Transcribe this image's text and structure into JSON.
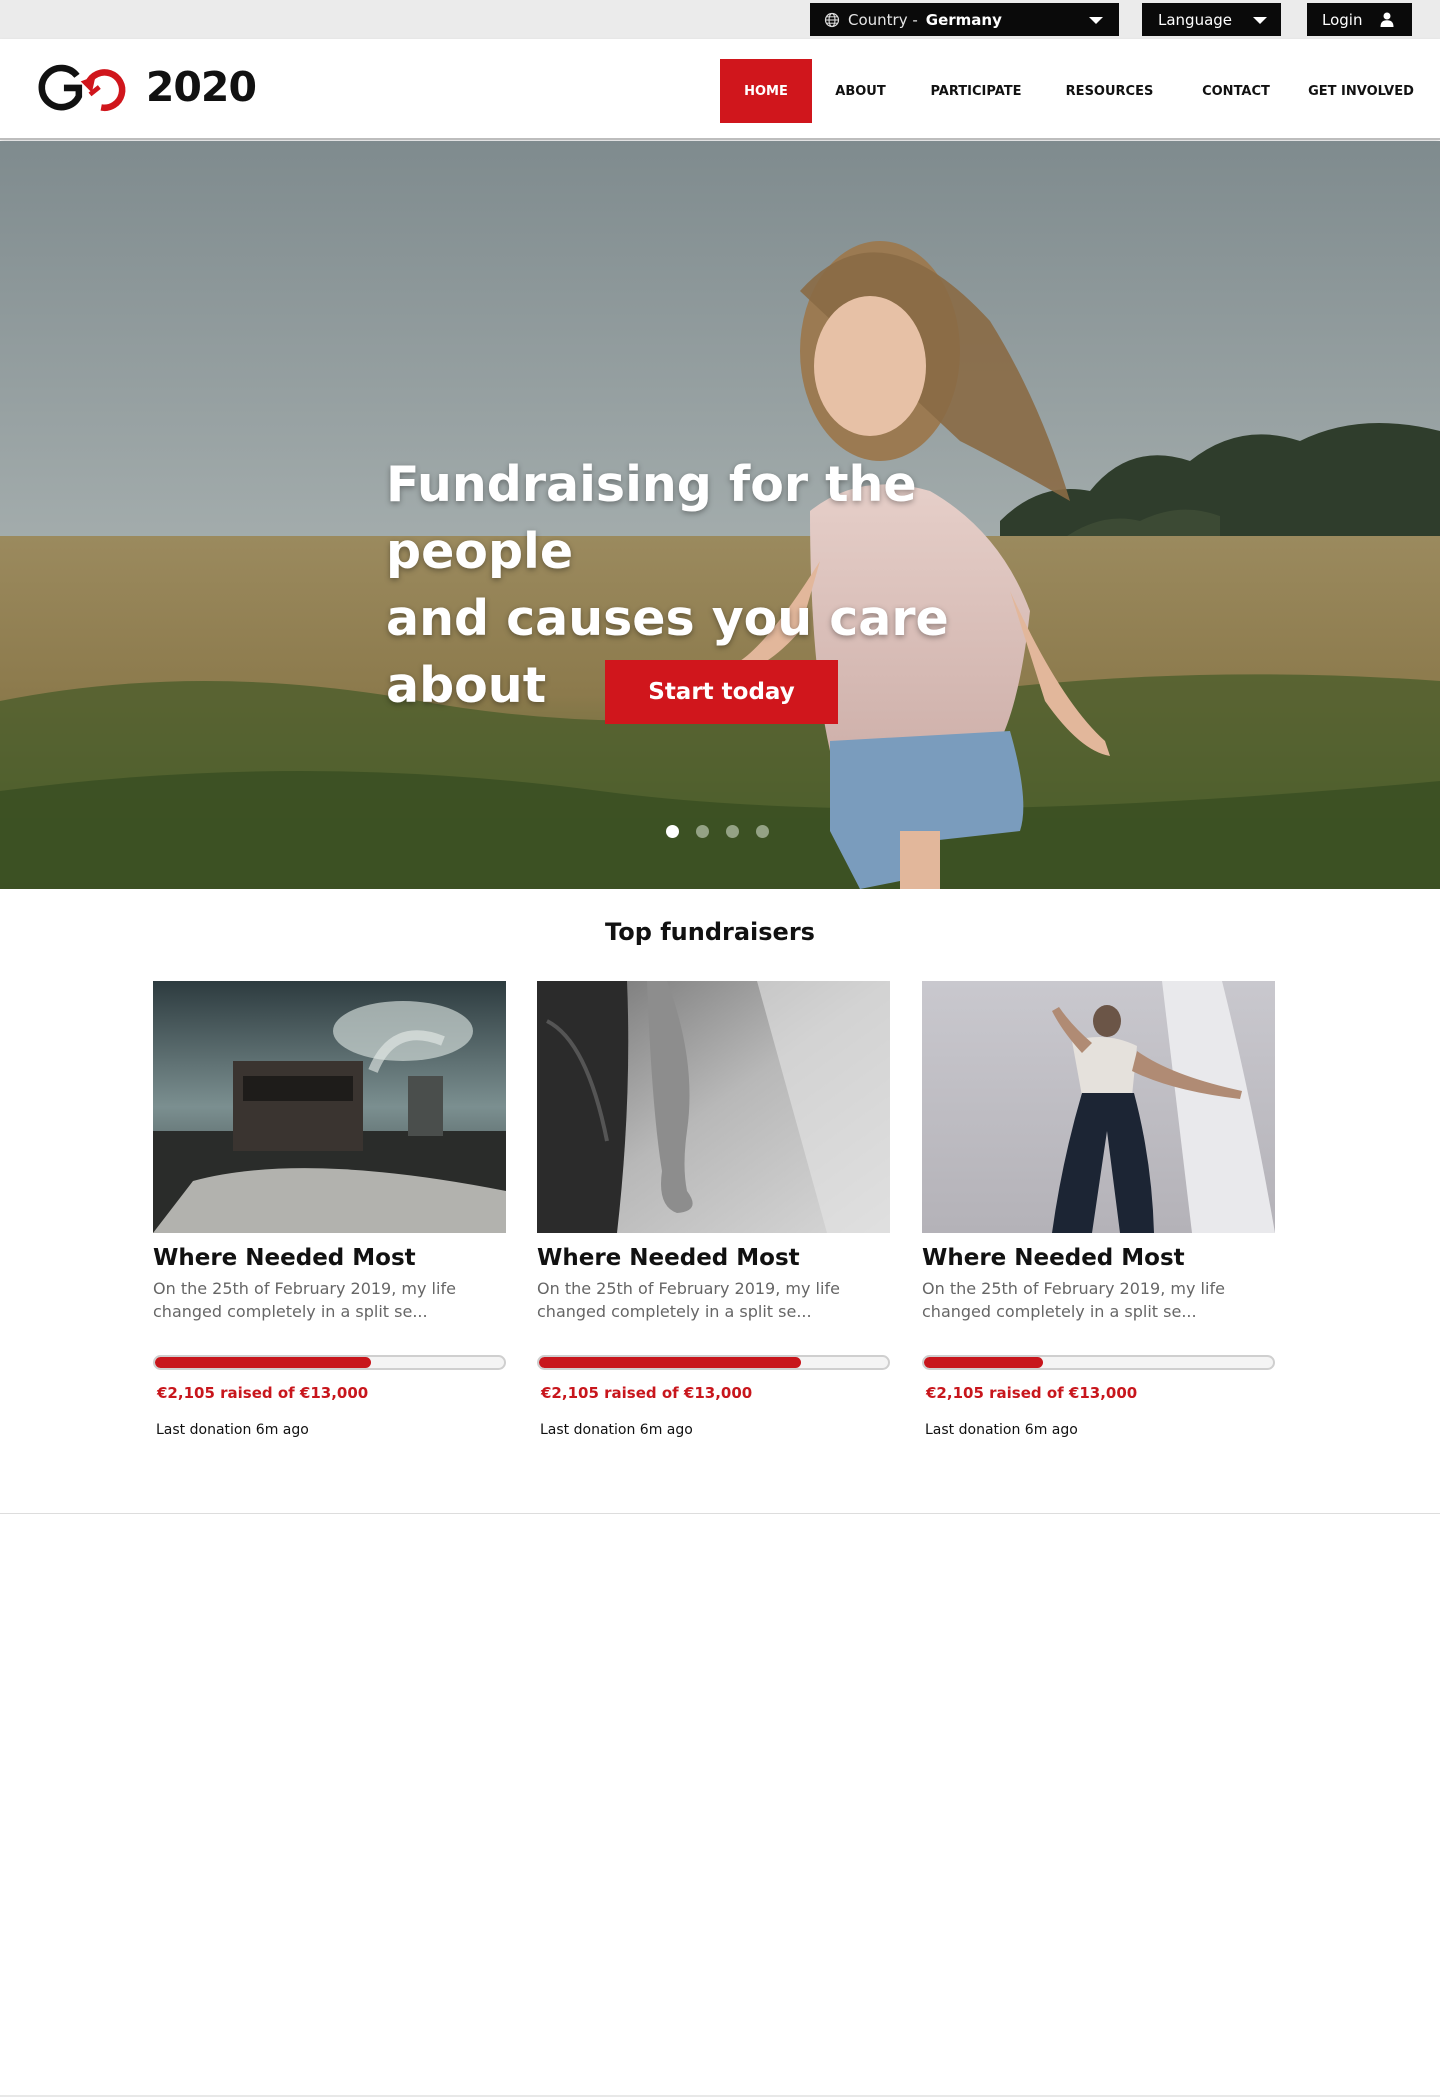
{
  "topbar": {
    "country_prefix": "Country -",
    "country_value": "Germany",
    "language_label": "Language",
    "login_label": "Login"
  },
  "header": {
    "logo_year": "2020",
    "nav": [
      {
        "label": "HOME",
        "active": true
      },
      {
        "label": "ABOUT"
      },
      {
        "label": "PARTICIPATE"
      },
      {
        "label": "RESOURCES"
      },
      {
        "label": "CONTACT"
      },
      {
        "label": "GET INVOLVED"
      }
    ]
  },
  "hero": {
    "title_line1": "Fundraising for the people",
    "title_line2": "and causes you care about",
    "cta_label": "Start today",
    "slides": 4,
    "active_slide": 1
  },
  "fundraisers": {
    "title": "Top fundraisers",
    "cards": [
      {
        "title": "Where Needed Most",
        "excerpt": "On the 25th of February 2019, my life changed completely in a split se...",
        "raised_text": "€2,105 raised of €13,000",
        "progress": 0.62,
        "last_donation": "Last donation 6m ago"
      },
      {
        "title": "Where Needed Most",
        "excerpt": "On the 25th of February 2019, my life changed completely in a split se...",
        "raised_text": "€2,105 raised of €13,000",
        "progress": 0.75,
        "last_donation": "Last donation 6m ago"
      },
      {
        "title": "Where Needed Most",
        "excerpt": "On the 25th of February 2019, my life changed completely in a split se...",
        "raised_text": "€2,105 raised of €13,000",
        "progress": 0.34,
        "last_donation": "Last donation 6m ago"
      }
    ]
  },
  "colors": {
    "brand_red": "#d0161c",
    "dark": "#0a0a0a"
  },
  "icons": {
    "globe": "globe-icon",
    "caret": "chevron-down-icon",
    "user": "user-icon"
  }
}
